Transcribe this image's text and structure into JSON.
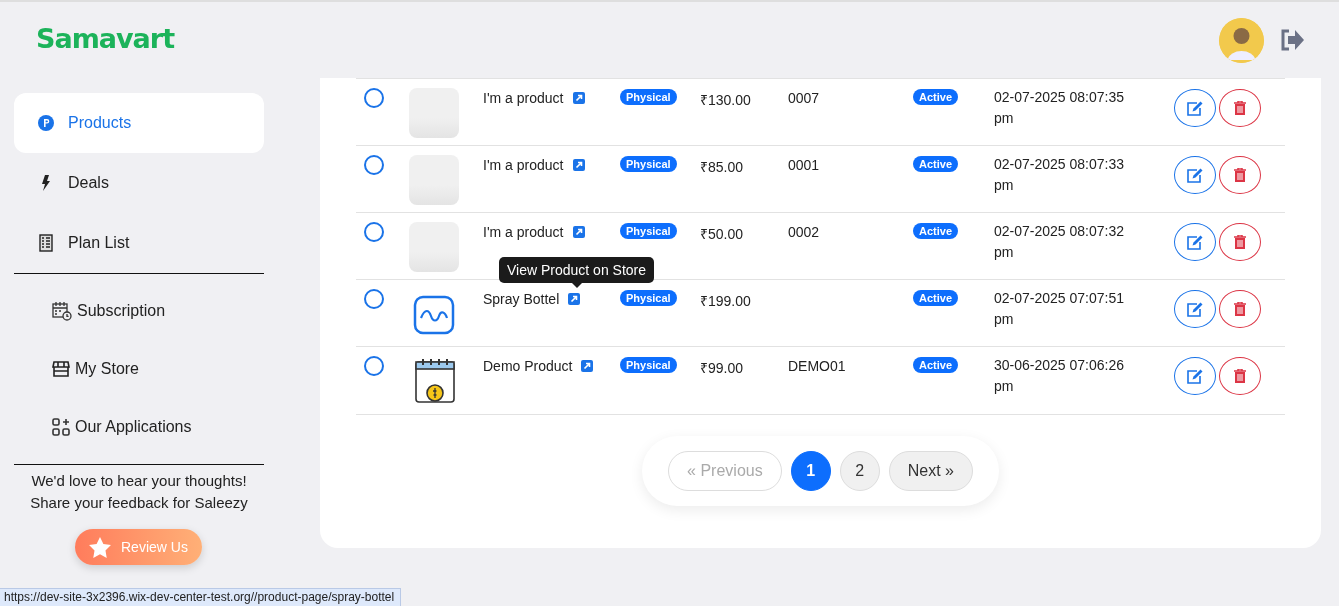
{
  "brand": {
    "logo": "Samavart"
  },
  "sidebar": {
    "groups": [
      {
        "items": [
          {
            "label": "Products",
            "selected": true
          },
          {
            "label": "Deals",
            "selected": false
          },
          {
            "label": "Plan List",
            "selected": false
          }
        ]
      },
      {
        "items": [
          {
            "label": "Subscription",
            "selected": false
          },
          {
            "label": "My Store",
            "selected": false
          },
          {
            "label": "Our Applications",
            "selected": false
          }
        ]
      }
    ],
    "feedback": "We'd love to hear your thoughts! Share your feedback for Saleezy",
    "review_button": "Review Us"
  },
  "table": {
    "rows": [
      {
        "checked": false,
        "kind": "photo",
        "name": "I'm a product",
        "type": "Physical",
        "price": "₹130.00",
        "sku": "0007",
        "status": "Active",
        "date": "02-07-2025 08:07:35 pm"
      },
      {
        "checked": false,
        "kind": "photo",
        "name": "I'm a product",
        "type": "Physical",
        "price": "₹85.00",
        "sku": "0001",
        "status": "Active",
        "date": "02-07-2025 08:07:33 pm"
      },
      {
        "checked": false,
        "kind": "photo",
        "name": "I'm a product",
        "type": "Physical",
        "price": "₹50.00",
        "sku": "0002",
        "status": "Active",
        "date": "02-07-2025 08:07:32 pm"
      },
      {
        "checked": false,
        "kind": "illustration",
        "name": "Spray Bottel",
        "type": "Physical",
        "price": "₹199.00",
        "status": "Active",
        "date": "02-07-2025 07:07:51 pm",
        "tooltip": "View Product on Store"
      },
      {
        "checked": false,
        "kind": "calendar",
        "name": "Demo Product",
        "type": "Physical",
        "price": "₹99.00",
        "sku": "DEMO01",
        "status": "Active",
        "date": "30-06-2025 07:06:26 pm"
      }
    ]
  },
  "pagination": {
    "previous": {
      "label": "« Previous",
      "disabled": true
    },
    "pages": [
      {
        "label": "1",
        "selected": true
      },
      {
        "label": "2",
        "selected": false
      }
    ],
    "next": {
      "label": "Next »",
      "disabled": false
    }
  },
  "status_bar": "https://dev-site-3x2396.wix-dev-center-test.org//product-page/spray-bottel"
}
